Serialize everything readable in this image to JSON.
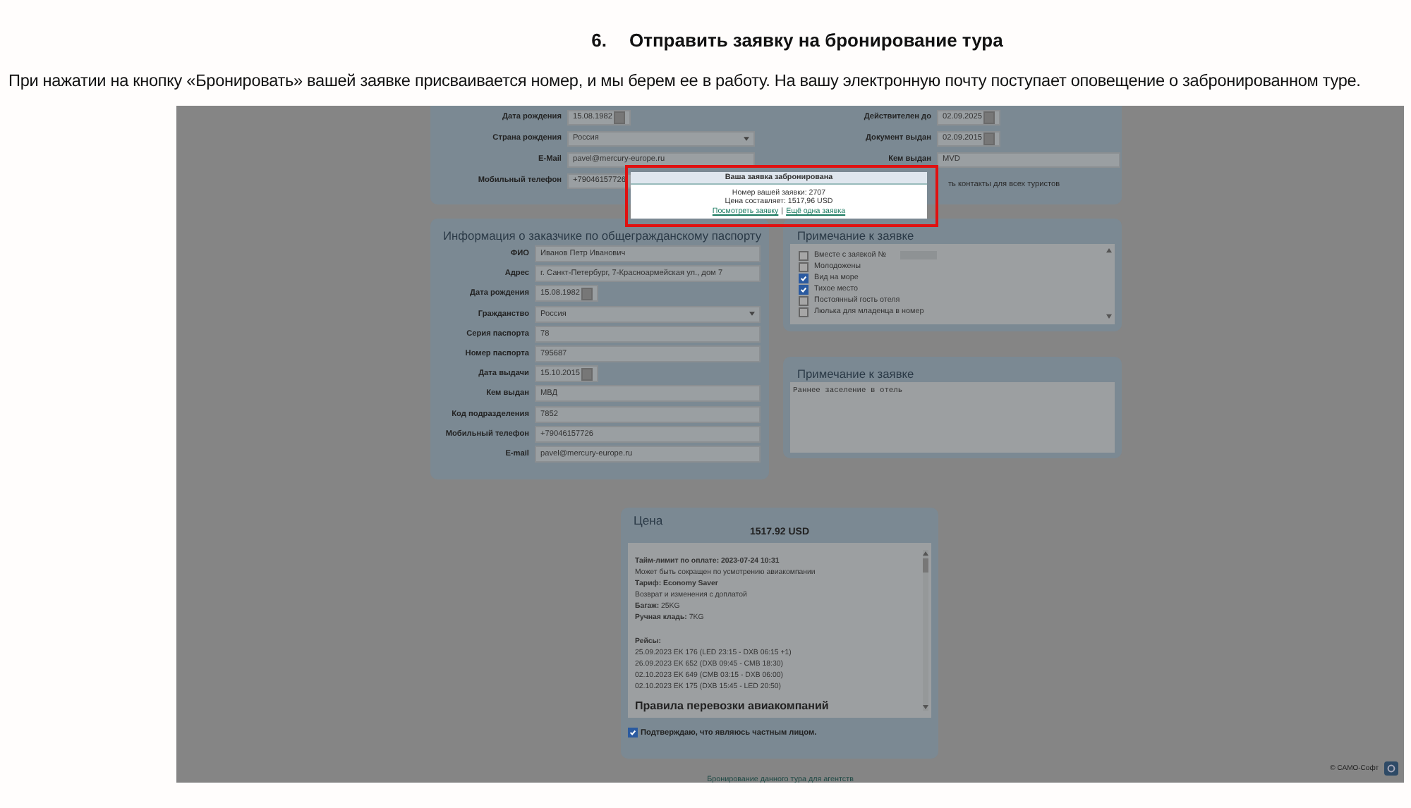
{
  "doc": {
    "number": "6.",
    "heading": "Отправить заявку на бронирование тура",
    "paragraph": "При нажатии на кнопку «Бронировать» вашей заявке присваивается номер, и мы берем ее в работу. На вашу электронную почту поступает оповещение о забронированном туре."
  },
  "top_form": {
    "left": [
      {
        "label": "Дата рождения",
        "value": "15.08.1982",
        "kind": "date"
      },
      {
        "label": "Страна рождения",
        "value": "Россия",
        "kind": "select"
      },
      {
        "label": "E-Mail",
        "value": "pavel@mercury-europe.ru",
        "kind": "text"
      },
      {
        "label": "Мобильный телефон",
        "value": "+79046157726",
        "kind": "text"
      }
    ],
    "right": [
      {
        "label": "Действителен до",
        "value": "02.09.2025",
        "kind": "date"
      },
      {
        "label": "Документ выдан",
        "value": "02.09.2015",
        "kind": "date"
      },
      {
        "label": "Кем выдан",
        "value": "MVD",
        "kind": "text"
      }
    ],
    "note": "ть контакты для всех туристов"
  },
  "modal": {
    "title": "Ваша заявка забронирована",
    "lines": [
      "Номер вашей заявки: 2707",
      "Цена составляет: 1517,96 USD"
    ],
    "links": [
      "Посмотреть заявку",
      "Ещё одна заявка"
    ],
    "separator": "|"
  },
  "customer": {
    "title": "Информация о заказчике по общегражданскому паспорту",
    "fields": [
      {
        "label": "ФИО",
        "value": "Иванов Петр Иванович",
        "kind": "text"
      },
      {
        "label": "Адрес",
        "value": "г. Санкт-Петербург, 7-Красноармейская ул., дом 7",
        "kind": "text"
      },
      {
        "label": "Дата рождения",
        "value": "15.08.1982",
        "kind": "date"
      },
      {
        "label": "Гражданство",
        "value": "Россия",
        "kind": "select"
      },
      {
        "label": "Серия паспорта",
        "value": "78",
        "kind": "text"
      },
      {
        "label": "Номер паспорта",
        "value": "795687",
        "kind": "text"
      },
      {
        "label": "Дата выдачи",
        "value": "15.10.2015",
        "kind": "date"
      },
      {
        "label": "Кем выдан",
        "value": "МВД",
        "kind": "text"
      },
      {
        "label": "Код подразделения",
        "value": "7852",
        "kind": "text"
      },
      {
        "label": "Мобильный телефон",
        "value": "+79046157726",
        "kind": "text"
      },
      {
        "label": "E-mail",
        "value": "pavel@mercury-europe.ru",
        "kind": "text"
      }
    ]
  },
  "notes": {
    "title": "Примечание к заявке",
    "options": [
      {
        "label": "Вместе с заявкой №",
        "checked": false,
        "kind": "with_input"
      },
      {
        "label": "Молодожены",
        "checked": false,
        "kind": "plain"
      },
      {
        "label": "Вид на море",
        "checked": true,
        "kind": "plain"
      },
      {
        "label": "Тихое место",
        "checked": true,
        "kind": "plain"
      },
      {
        "label": "Постоянный гость отеля",
        "checked": false,
        "kind": "plain"
      },
      {
        "label": "Люлька для младенца в номер",
        "checked": false,
        "kind": "plain"
      }
    ]
  },
  "comment": {
    "title": "Примечание к заявке",
    "text": "Раннее заселение в отель"
  },
  "price": {
    "title": "Цена",
    "total": "1517.92 USD",
    "groups": [
      [
        "**Тайм-лимит по оплате: 2023-07-24 10:31**",
        "Может быть сокращен по усмотрению авиакомпании",
        "**Тариф: Economy Saver**",
        "Возврат и изменения с доплатой",
        "**Багаж:** 25KG",
        "**Ручная кладь:** 7KG"
      ],
      [
        "**Рейсы:**",
        "25.09.2023 EK 176 (LED 23:15 - DXB 06:15 +1)",
        "26.09.2023 EK 652 (DXB 09:45 - CMB 18:30)",
        "02.10.2023 EK 649 (CMB 03:15 - DXB 06:00)",
        "02.10.2023 EK 175 (DXB 15:45 - LED 20:50)"
      ]
    ],
    "section": "Правила перевозки авиакомпаний",
    "confirm": {
      "label": "Подтверждаю, что являюсь частным лицом.",
      "checked": true
    }
  },
  "footer_link": "Бронирование данного тура для агентств",
  "copyright": "© САМО-Софт"
}
